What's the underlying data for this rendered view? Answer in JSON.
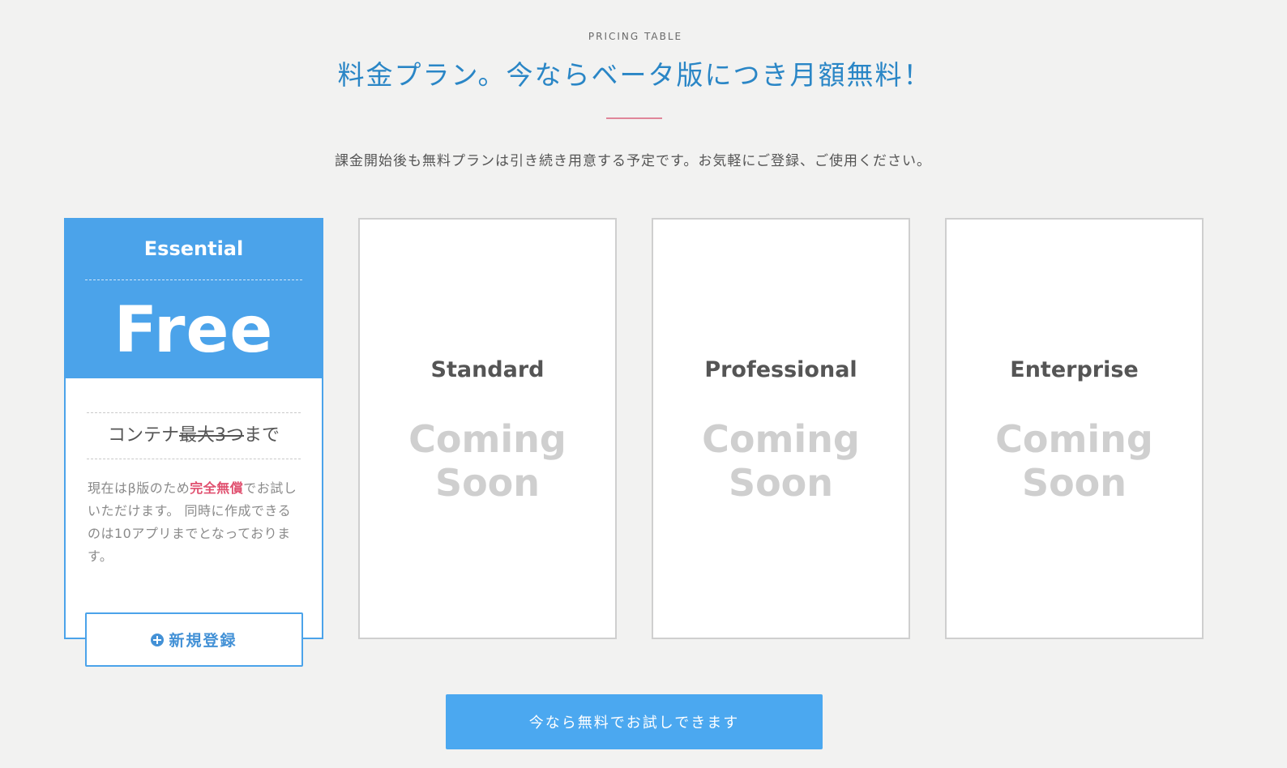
{
  "header": {
    "eyebrow": "PRICING TABLE",
    "title": "料金プラン。今ならベータ版につき月額無料！",
    "subtitle": "課金開始後も無料プランは引き続き用意する予定です。お気軽にご登録、ご使用ください。"
  },
  "plans": {
    "essential": {
      "name": "Essential",
      "price": "Free",
      "feature_prefix": "コンテナ",
      "feature_struck": "最大3つ",
      "feature_suffix": "まで",
      "desc_part1": "現在はβ版のため",
      "desc_highlight": "完全無償",
      "desc_part2": "でお試しいただけます。 同時に作成できるのは10アプリまでとなっております。",
      "button_label": "新規登録",
      "button_icon": "plus-circle-icon"
    },
    "standard": {
      "name": "Standard",
      "status_line1": "Coming",
      "status_line2": "Soon"
    },
    "professional": {
      "name": "Professional",
      "status_line1": "Coming",
      "status_line2": "Soon"
    },
    "enterprise": {
      "name": "Enterprise",
      "status_line1": "Coming",
      "status_line2": "Soon"
    }
  },
  "cta": {
    "label": "今なら無料でお試しできます"
  },
  "colors": {
    "background": "#f2f2f1",
    "accent_blue": "#4ba3ea",
    "title_blue": "#2a86c6",
    "highlight_pink": "#e0506f",
    "rule_pink": "#e0869a",
    "coming_soon_gray": "#cfcfcf"
  }
}
